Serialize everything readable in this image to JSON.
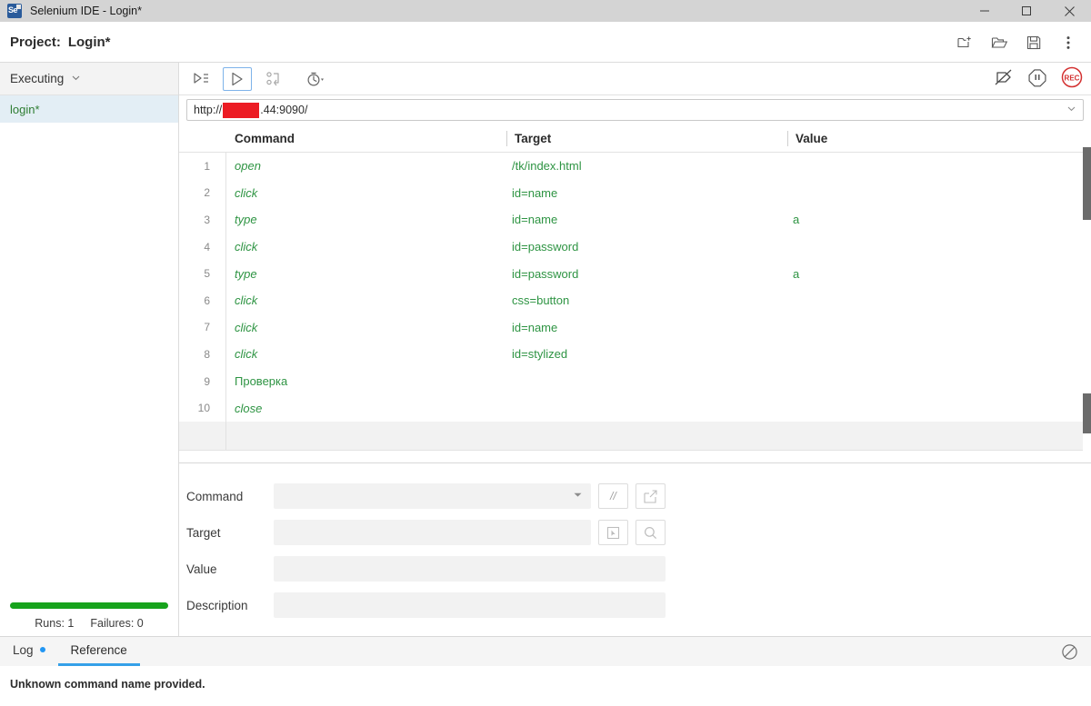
{
  "titlebar": {
    "title": "Selenium IDE - Login*",
    "app_icon": "selenium-logo-icon",
    "minimize_icon": "minimize-icon",
    "maximize_icon": "maximize-icon",
    "close_icon": "close-icon"
  },
  "projectbar": {
    "label": "Project:",
    "name": "Login*",
    "actions": [
      {
        "icon": "new-project-icon",
        "name": "new-project-button"
      },
      {
        "icon": "open-project-icon",
        "name": "open-project-button"
      },
      {
        "icon": "save-project-icon",
        "name": "save-project-button"
      },
      {
        "icon": "more-options-icon",
        "name": "more-options-button"
      }
    ]
  },
  "sidebar": {
    "header": "Executing",
    "header_caret": "chevron-down-icon",
    "tests": [
      {
        "label": "login*",
        "selected": true
      }
    ],
    "progress_percent": 100,
    "progress_color": "#17a31c",
    "runs_label": "Runs: 1",
    "failures_label": "Failures: 0"
  },
  "toolbar": {
    "run_all_label": "run-all-tests",
    "run_current_label": "run-current-test",
    "step_label": "step-over",
    "speed_label": "test-speed",
    "disable_breakpoints_label": "disable-breakpoints",
    "pause_label": "pause",
    "record_label": "REC"
  },
  "urlbar": {
    "prefix": "http://",
    "redacted": true,
    "suffix": ".44:9090/",
    "caret": "chevron-down-icon"
  },
  "table": {
    "headers": [
      "Command",
      "Target",
      "Value"
    ],
    "rows": [
      {
        "num": "1",
        "command": "open",
        "target": "/tk/index.html",
        "value": "",
        "italic": true
      },
      {
        "num": "2",
        "command": "click",
        "target": "id=name",
        "value": "",
        "italic": true
      },
      {
        "num": "3",
        "command": "type",
        "target": "id=name",
        "value": "a",
        "italic": true
      },
      {
        "num": "4",
        "command": "click",
        "target": "id=password",
        "value": "",
        "italic": true
      },
      {
        "num": "5",
        "command": "type",
        "target": "id=password",
        "value": "a",
        "italic": true
      },
      {
        "num": "6",
        "command": "click",
        "target": "css=button",
        "value": "",
        "italic": true
      },
      {
        "num": "7",
        "command": "click",
        "target": "id=name",
        "value": "",
        "italic": true
      },
      {
        "num": "8",
        "command": "click",
        "target": "id=stylized",
        "value": "",
        "italic": true
      },
      {
        "num": "9",
        "command": "Проверка",
        "target": "",
        "value": "",
        "italic": false
      },
      {
        "num": "10",
        "command": "close",
        "target": "",
        "value": "",
        "italic": true
      }
    ]
  },
  "form": {
    "command_label": "Command",
    "command_value": "",
    "command_caret": "chevron-down-icon",
    "comment_button": "//",
    "open_button_icon": "open-external-icon",
    "target_label": "Target",
    "target_value": "",
    "select_target_icon": "select-target-icon",
    "find_target_icon": "search-icon",
    "value_label": "Value",
    "value_value": "",
    "description_label": "Description",
    "description_value": ""
  },
  "bottom": {
    "tabs": [
      {
        "label": "Log",
        "active": false,
        "dot": true
      },
      {
        "label": "Reference",
        "active": true,
        "dot": false
      }
    ],
    "clear_icon": "clear-log-icon",
    "message": "Unknown command name provided."
  }
}
